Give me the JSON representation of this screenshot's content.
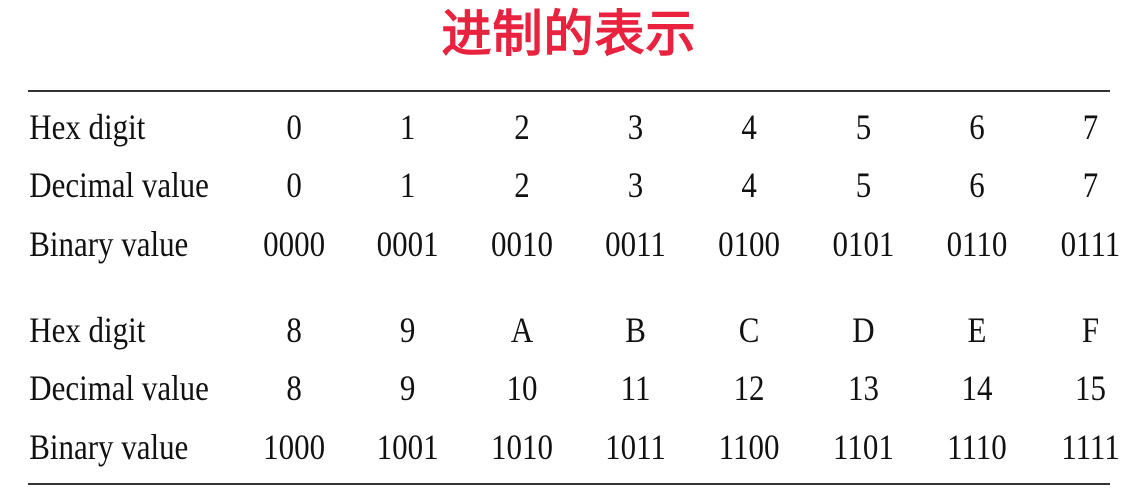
{
  "title": "进制的表示",
  "table": {
    "groups": [
      {
        "rows": [
          {
            "label": "Hex digit",
            "values": [
              "0",
              "1",
              "2",
              "3",
              "4",
              "5",
              "6",
              "7"
            ]
          },
          {
            "label": "Decimal value",
            "values": [
              "0",
              "1",
              "2",
              "3",
              "4",
              "5",
              "6",
              "7"
            ]
          },
          {
            "label": "Binary value",
            "values": [
              "0000",
              "0001",
              "0010",
              "0011",
              "0100",
              "0101",
              "0110",
              "0111"
            ]
          }
        ]
      },
      {
        "rows": [
          {
            "label": "Hex digit",
            "values": [
              "8",
              "9",
              "A",
              "B",
              "C",
              "D",
              "E",
              "F"
            ]
          },
          {
            "label": "Decimal value",
            "values": [
              "8",
              "9",
              "10",
              "11",
              "12",
              "13",
              "14",
              "15"
            ]
          },
          {
            "label": "Binary value",
            "values": [
              "1000",
              "1001",
              "1010",
              "1011",
              "1100",
              "1101",
              "1110",
              "1111"
            ]
          }
        ]
      }
    ]
  },
  "colors": {
    "title": "#e8223f",
    "text": "#111111",
    "rule": "#333333"
  }
}
